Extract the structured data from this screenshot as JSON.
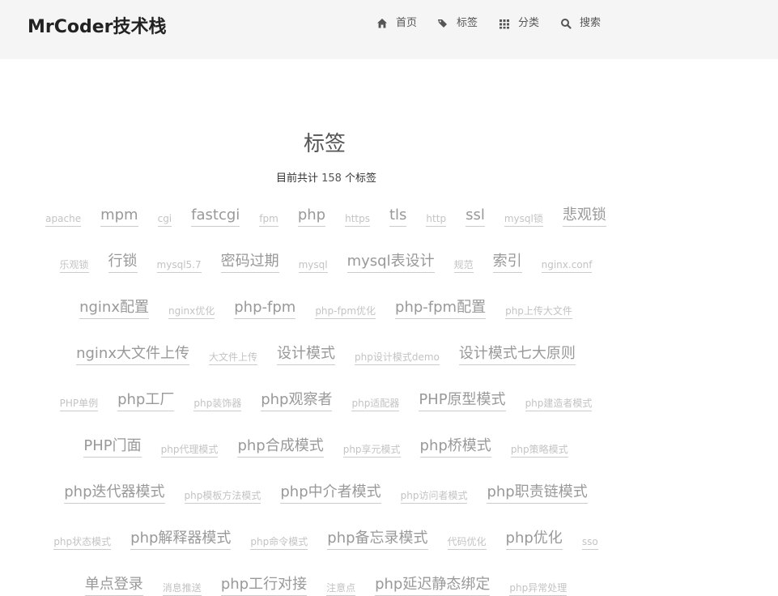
{
  "header": {
    "brand": "MrCoder技术栈",
    "nav": [
      {
        "label": "首页",
        "icon": "home-icon"
      },
      {
        "label": "标签",
        "icon": "tags-icon"
      },
      {
        "label": "分类",
        "icon": "grid-icon"
      },
      {
        "label": "搜索",
        "icon": "search-icon"
      }
    ]
  },
  "page": {
    "title": "标签",
    "count_prefix": "目前共计 ",
    "count_value": "158",
    "count_suffix": " 个标签"
  },
  "tag_rows": [
    [
      {
        "label": "apache",
        "size": "s1"
      },
      {
        "label": "mpm",
        "size": "s2"
      },
      {
        "label": "cgi",
        "size": "s1"
      },
      {
        "label": "fastcgi",
        "size": "s2"
      },
      {
        "label": "fpm",
        "size": "s1"
      },
      {
        "label": "php",
        "size": "s2"
      },
      {
        "label": "https",
        "size": "s1"
      },
      {
        "label": "tls",
        "size": "s2"
      },
      {
        "label": "http",
        "size": "s1"
      },
      {
        "label": "ssl",
        "size": "s2"
      },
      {
        "label": "mysql锁",
        "size": "s1"
      },
      {
        "label": "悲观锁",
        "size": "s2"
      }
    ],
    [
      {
        "label": "乐观锁",
        "size": "s1"
      },
      {
        "label": "行锁",
        "size": "s2"
      },
      {
        "label": "mysql5.7",
        "size": "s1"
      },
      {
        "label": "密码过期",
        "size": "s2"
      },
      {
        "label": "mysql",
        "size": "s1"
      },
      {
        "label": "mysql表设计",
        "size": "s2"
      },
      {
        "label": "规范",
        "size": "s1"
      },
      {
        "label": "索引",
        "size": "s2"
      },
      {
        "label": "nginx.conf",
        "size": "s1"
      }
    ],
    [
      {
        "label": "nginx配置",
        "size": "s2"
      },
      {
        "label": "nginx优化",
        "size": "s1"
      },
      {
        "label": "php-fpm",
        "size": "s2"
      },
      {
        "label": "php-fpm优化",
        "size": "s1"
      },
      {
        "label": "php-fpm配置",
        "size": "s2"
      },
      {
        "label": "php上传大文件",
        "size": "s1"
      }
    ],
    [
      {
        "label": "nginx大文件上传",
        "size": "s2"
      },
      {
        "label": "大文件上传",
        "size": "s1"
      },
      {
        "label": "设计模式",
        "size": "s2"
      },
      {
        "label": "php设计模式demo",
        "size": "s1"
      },
      {
        "label": "设计模式七大原则",
        "size": "s2"
      }
    ],
    [
      {
        "label": "PHP单例",
        "size": "s1"
      },
      {
        "label": "php工厂",
        "size": "s2"
      },
      {
        "label": "php装饰器",
        "size": "s1"
      },
      {
        "label": "php观察者",
        "size": "s2"
      },
      {
        "label": "php适配器",
        "size": "s1"
      },
      {
        "label": "PHP原型模式",
        "size": "s2"
      },
      {
        "label": "php建造者模式",
        "size": "s1"
      }
    ],
    [
      {
        "label": "PHP门面",
        "size": "s2"
      },
      {
        "label": "php代理模式",
        "size": "s1"
      },
      {
        "label": "php合成模式",
        "size": "s2"
      },
      {
        "label": "php享元模式",
        "size": "s1"
      },
      {
        "label": "php桥模式",
        "size": "s2"
      },
      {
        "label": "php策略模式",
        "size": "s1"
      }
    ],
    [
      {
        "label": "php迭代器模式",
        "size": "s2"
      },
      {
        "label": "php模板方法模式",
        "size": "s1"
      },
      {
        "label": "php中介者模式",
        "size": "s2"
      },
      {
        "label": "php访问者模式",
        "size": "s1"
      },
      {
        "label": "php职责链模式",
        "size": "s2"
      }
    ],
    [
      {
        "label": "php状态模式",
        "size": "s1"
      },
      {
        "label": "php解释器模式",
        "size": "s2"
      },
      {
        "label": "php命令模式",
        "size": "s1"
      },
      {
        "label": "php备忘录模式",
        "size": "s2"
      },
      {
        "label": "代码优化",
        "size": "s1"
      },
      {
        "label": "php优化",
        "size": "s2"
      },
      {
        "label": "sso",
        "size": "s1"
      }
    ],
    [
      {
        "label": "单点登录",
        "size": "s2"
      },
      {
        "label": "消息推送",
        "size": "s1"
      },
      {
        "label": "php工行对接",
        "size": "s2"
      },
      {
        "label": "注意点",
        "size": "s1"
      },
      {
        "label": "php延迟静态绑定",
        "size": "s2"
      },
      {
        "label": "php异常处理",
        "size": "s1"
      }
    ]
  ]
}
